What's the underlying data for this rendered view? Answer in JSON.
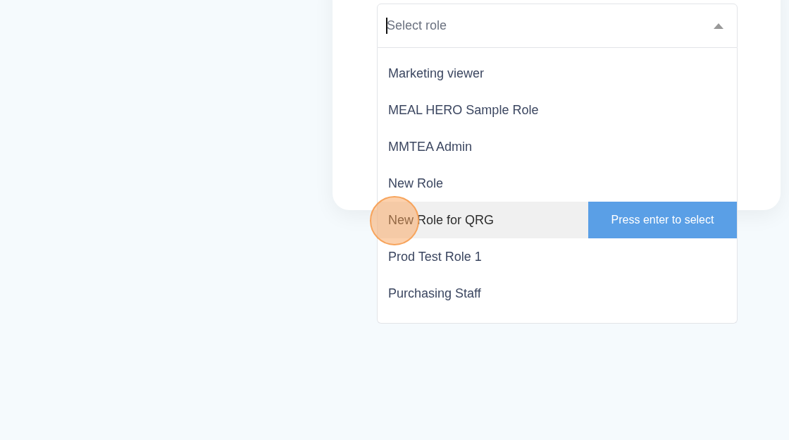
{
  "role_select": {
    "placeholder": "Select role",
    "expanded": true,
    "hint": "Press enter to select",
    "options": [
      {
        "label": "Marketing viewer",
        "selected": false
      },
      {
        "label": "MEAL HERO Sample Role",
        "selected": false
      },
      {
        "label": "MMTEA Admin",
        "selected": false
      },
      {
        "label": "New Role",
        "selected": false
      },
      {
        "label": "New Role for QRG",
        "selected": true
      },
      {
        "label": "Prod Test Role 1",
        "selected": false
      },
      {
        "label": "Purchasing Staff",
        "selected": false
      }
    ]
  }
}
